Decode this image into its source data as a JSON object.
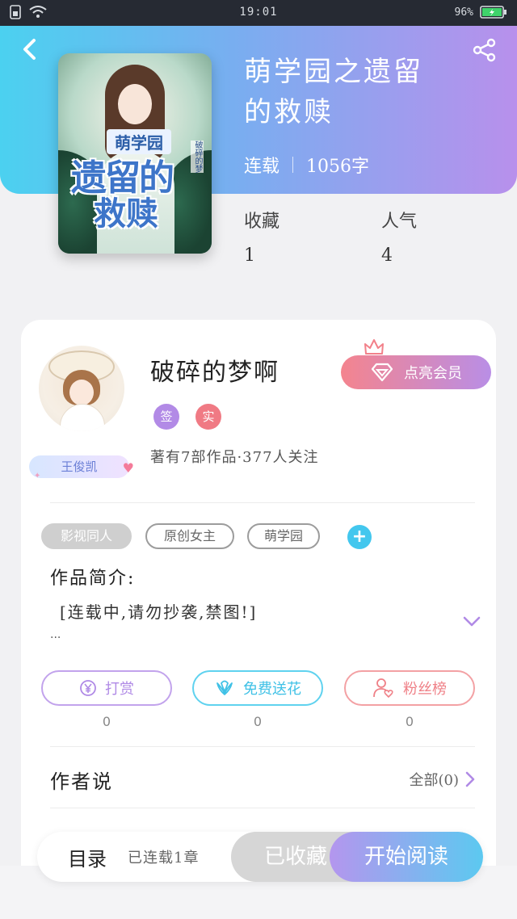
{
  "statusbar": {
    "time": "19:01",
    "battery": "96%"
  },
  "book": {
    "title": "萌学园之遗留的救赎",
    "status": "连载",
    "word_count": "1056字",
    "cover_series": "萌学园",
    "cover_title_1": "遗留的",
    "cover_title_2": "救赎",
    "cover_side_text": "破碎的梦"
  },
  "stats": [
    {
      "label": "收藏",
      "value": "1"
    },
    {
      "label": "人气",
      "value": "4"
    }
  ],
  "author": {
    "name": "破碎的梦啊",
    "badge1": "签",
    "badge2": "实",
    "badge1_color": "#b28ae6",
    "badge2_color": "#f07a84",
    "fan_badge": "王俊凯",
    "meta": "著有7部作品·377人关注"
  },
  "vip_button": "点亮会员",
  "tags": [
    "影视同人",
    "原创女主",
    "萌学园"
  ],
  "intro": {
    "heading": "作品简介:",
    "text": "[连载中,请勿抄袭,禁图!]",
    "ellipsis": "..."
  },
  "actions": [
    {
      "label": "打赏",
      "count": "0",
      "icon": "yen-icon"
    },
    {
      "label": "免费送花",
      "count": "0",
      "icon": "flower-icon"
    },
    {
      "label": "粉丝榜",
      "count": "0",
      "icon": "user-heart-icon"
    }
  ],
  "author_says": {
    "title": "作者说",
    "all": "全部(0)"
  },
  "bottom": {
    "toc": "目录",
    "chapters": "已连载1章",
    "favorited": "已收藏",
    "read": "开始阅读"
  },
  "colors": {
    "hero_start": "#4bd1f0",
    "hero_end": "#b890ec",
    "accent_blue": "#43c7ee"
  }
}
